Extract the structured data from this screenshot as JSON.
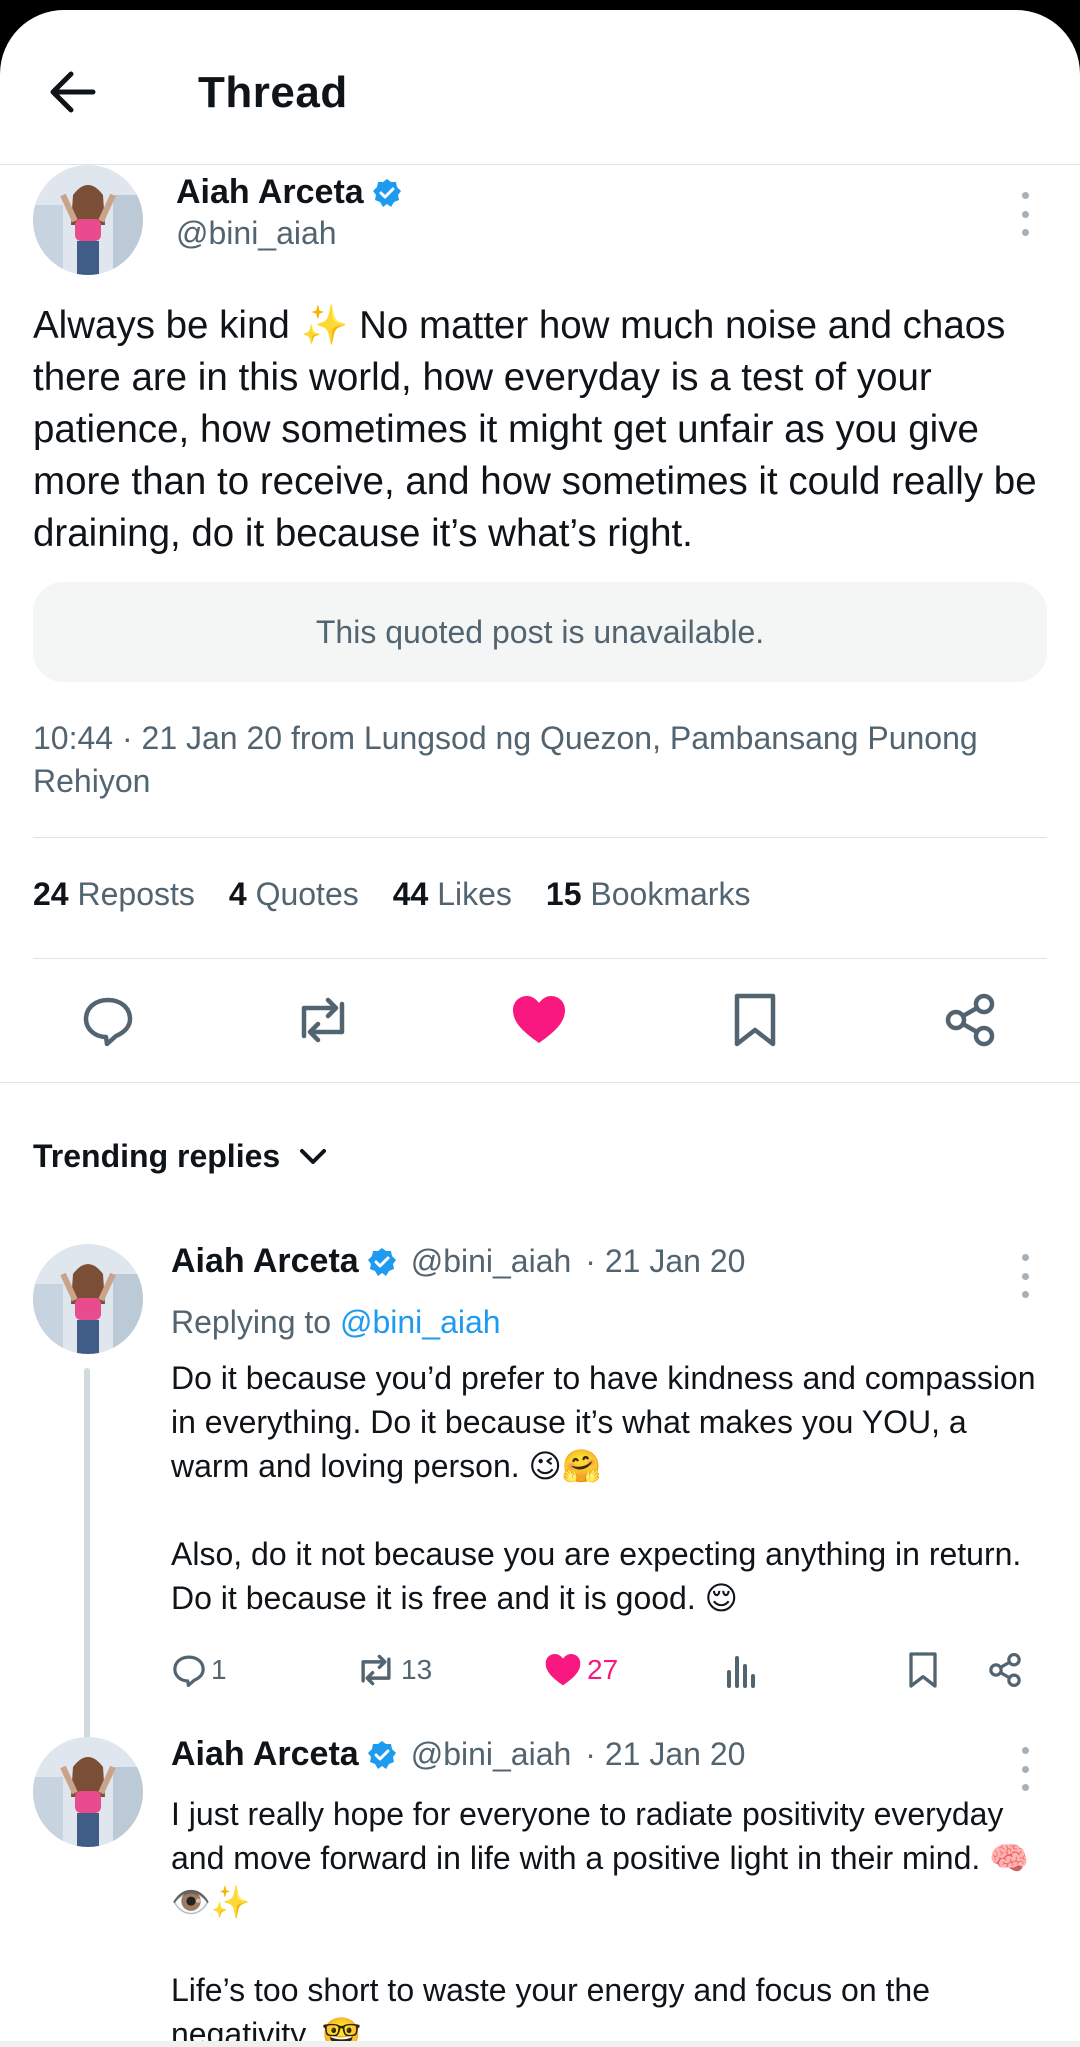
{
  "header": {
    "title": "Thread"
  },
  "main_tweet": {
    "author": {
      "name": "Aiah Arceta",
      "handle": "@bini_aiah"
    },
    "text": "Always be kind ✨ No matter how much noise and chaos there are in this world, how everyday is a test of your patience, how sometimes it might get unfair as you give more than to receive, and how sometimes it could really be draining, do it because it’s what’s right.",
    "quoted_notice": "This quoted post is unavailable.",
    "meta": "10:44 · 21 Jan 20 from Lungsod ng Quezon, Pambansang Punong Rehiyon",
    "stats": [
      {
        "count": "24",
        "label": "Reposts"
      },
      {
        "count": "4",
        "label": "Quotes"
      },
      {
        "count": "44",
        "label": "Likes"
      },
      {
        "count": "15",
        "label": "Bookmarks"
      }
    ],
    "actions": [
      "reply-icon",
      "repost-icon",
      "heart-icon",
      "bookmark-icon",
      "share-icon"
    ],
    "liked": true
  },
  "trending": {
    "label": "Trending replies"
  },
  "replies": [
    {
      "name": "Aiah Arceta",
      "handle": "@bini_aiah",
      "date": "· 21 Jan 20",
      "replying_prefix": "Replying to",
      "replying_handle": "@bini_aiah",
      "text": "Do it because you’d prefer to have kindness and compassion in everything. Do it because it’s what makes you YOU, a warm and loving person. 😉🤗\n\nAlso, do it not because you are expecting anything in return. Do it because it is free and it is good. 😌",
      "counts": {
        "replies": "1",
        "reposts": "13",
        "likes": "27"
      }
    },
    {
      "name": "Aiah Arceta",
      "handle": "@bini_aiah",
      "date": "· 21 Jan 20",
      "text": "I just really hope for everyone to radiate positivity everyday and move forward in life with a positive light in their mind. 🧠👁️✨\n\nLife’s too short to waste your energy and focus on the negativity. 🤓"
    }
  ],
  "colors": {
    "accent": "#1d9bf0",
    "like": "#f91880",
    "verified": "#1d9bf0",
    "secondary_text": "#536471",
    "divider": "#dfe3e6"
  }
}
